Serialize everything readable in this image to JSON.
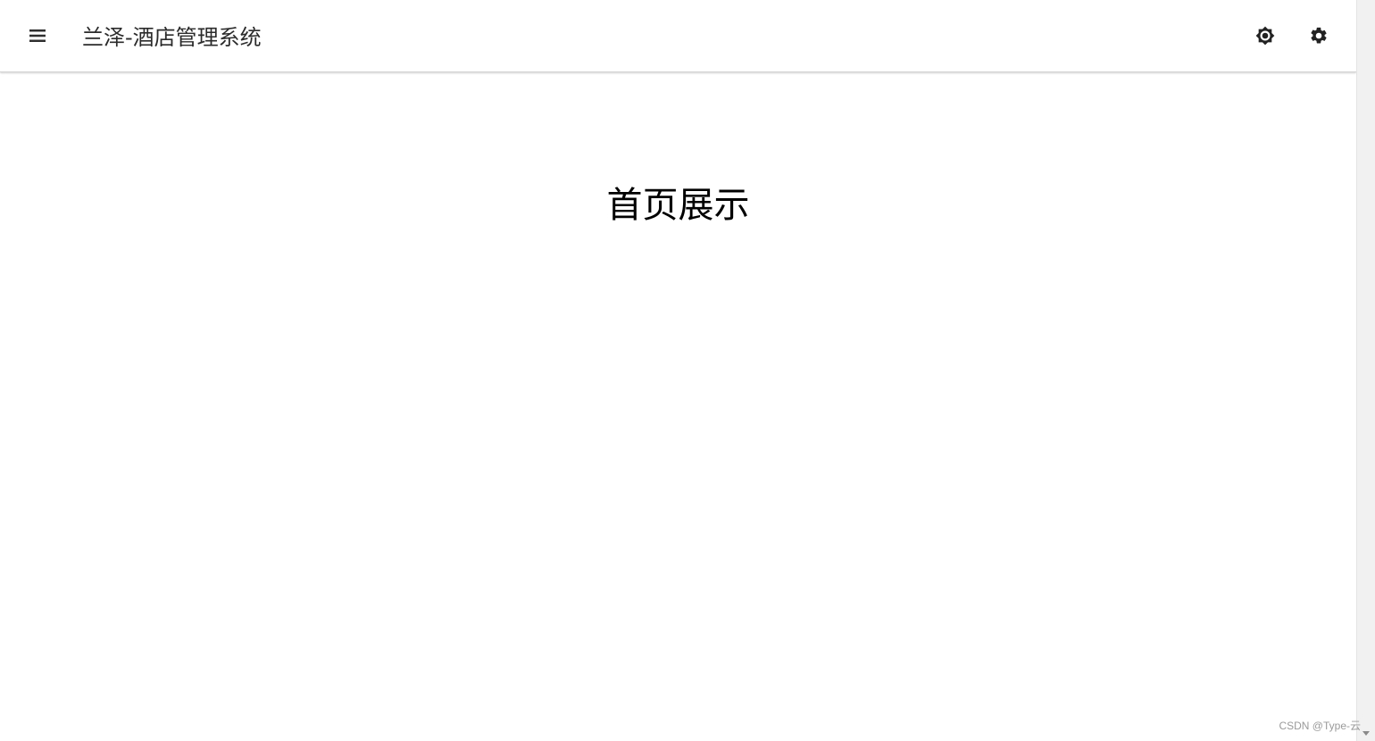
{
  "app": {
    "title": "兰泽-酒店管理系统"
  },
  "toolbar": {
    "menu_icon": "menu-icon",
    "theme_icon": "brightness-icon",
    "settings_icon": "gear-icon"
  },
  "main": {
    "heading": "首页展示"
  },
  "watermark": {
    "text": "CSDN @Type-云"
  },
  "colors": {
    "app_bar_background": "#ffffff",
    "text_primary": "#212121",
    "heading": "#000000"
  }
}
